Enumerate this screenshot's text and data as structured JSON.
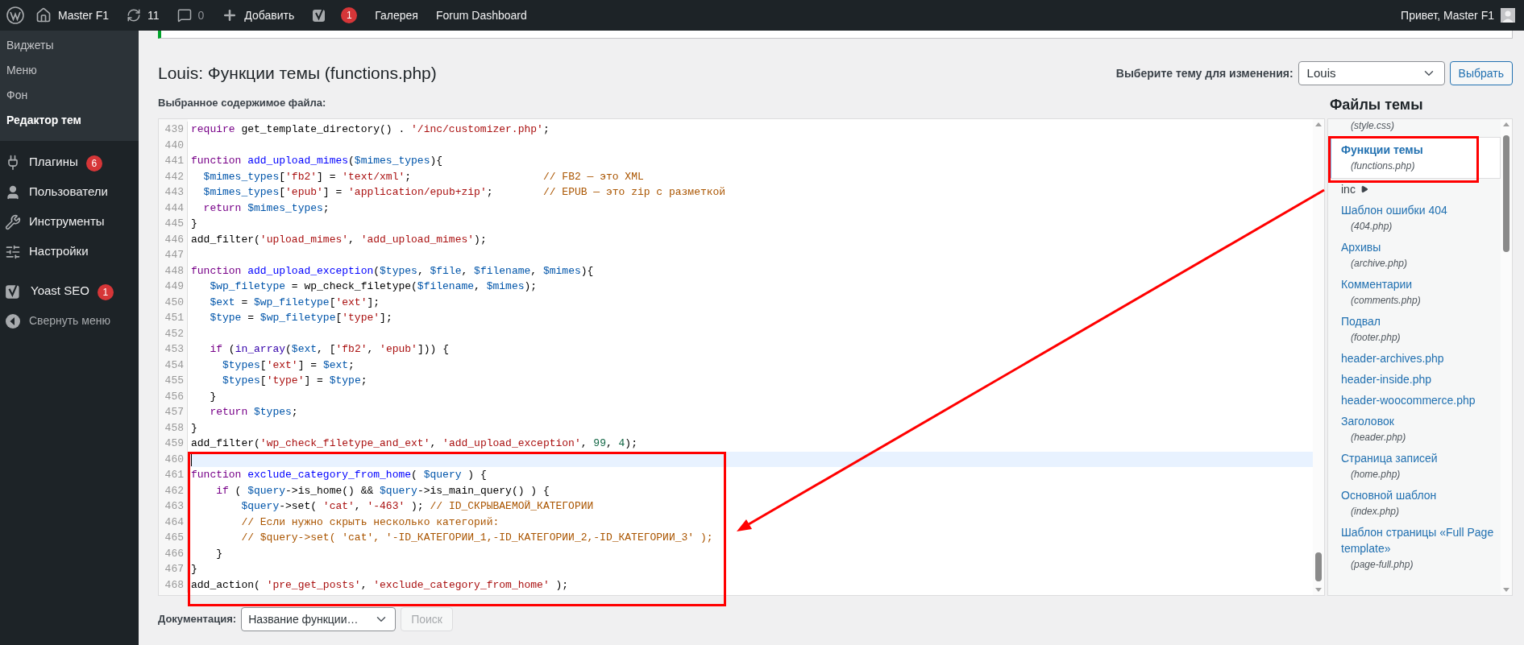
{
  "admin_bar": {
    "items": [
      {
        "label": "Master F1"
      },
      {
        "label": "11"
      },
      {
        "label": "0",
        "muted": true
      },
      {
        "label": "Добавить"
      },
      {
        "badge": "1"
      },
      {
        "label": "Галерея"
      },
      {
        "label": "Forum Dashboard"
      }
    ],
    "greeting": "Привет, Master F1"
  },
  "sidebar": {
    "submenu": [
      {
        "label": "Виджеты",
        "selected": false
      },
      {
        "label": "Меню",
        "selected": false
      },
      {
        "label": "Фон",
        "selected": false
      },
      {
        "label": "Редактор тем",
        "selected": true
      }
    ],
    "menu_groups": [
      {
        "items": [
          {
            "label": "Плагины",
            "badge": "6"
          },
          {
            "label": "Пользователи"
          },
          {
            "label": "Инструменты"
          },
          {
            "label": "Настройки"
          }
        ]
      },
      {
        "items": [
          {
            "label": "Yoast SEO",
            "badge": "1"
          },
          {
            "label": "Свернуть меню",
            "kind": "collapse"
          }
        ]
      }
    ]
  },
  "page": {
    "title": "Louis: Функции темы (functions.php)",
    "theme_picker": {
      "label": "Выберите тему для изменения:",
      "value": "Louis",
      "button": "Выбрать"
    },
    "content_label": "Выбранное содержимое файла:"
  },
  "code": {
    "lines": [
      {
        "number": "439",
        "active": false,
        "tokens": [
          {
            "kind": "keyword",
            "text": "require"
          },
          {
            "kind": "plain",
            "text": " get_template_directory() . "
          },
          {
            "kind": "string",
            "text": "'/inc/customizer.php'"
          },
          {
            "kind": "plain",
            "text": ";"
          }
        ]
      },
      {
        "number": "440",
        "active": false
      },
      {
        "number": "441",
        "active": false,
        "tokens": [
          {
            "kind": "keyword",
            "text": "function "
          },
          {
            "kind": "def",
            "text": "add_upload_mimes"
          },
          {
            "kind": "plain",
            "text": "("
          },
          {
            "kind": "variable",
            "text": "$mimes_types"
          },
          {
            "kind": "plain",
            "text": "){"
          }
        ]
      },
      {
        "number": "442",
        "active": false,
        "tokens": [
          {
            "kind": "variable",
            "text": "  $mimes_types"
          },
          {
            "kind": "plain",
            "text": "["
          },
          {
            "kind": "string",
            "text": "'fb2'"
          },
          {
            "kind": "plain",
            "text": "] = "
          },
          {
            "kind": "string",
            "text": "'text/xml'"
          },
          {
            "kind": "plain",
            "text": ";                     "
          },
          {
            "kind": "comment",
            "text": "// FB2 — это XML"
          }
        ]
      },
      {
        "number": "443",
        "active": false,
        "tokens": [
          {
            "kind": "variable",
            "text": "  $mimes_types"
          },
          {
            "kind": "plain",
            "text": "["
          },
          {
            "kind": "string",
            "text": "'epub'"
          },
          {
            "kind": "plain",
            "text": "] = "
          },
          {
            "kind": "string",
            "text": "'application/epub+zip'"
          },
          {
            "kind": "plain",
            "text": ";        "
          },
          {
            "kind": "comment",
            "text": "// EPUB — это zip с разметкой"
          }
        ]
      },
      {
        "number": "444",
        "active": false,
        "tokens": [
          {
            "kind": "keyword",
            "text": "  return "
          },
          {
            "kind": "variable",
            "text": "$mimes_types"
          },
          {
            "kind": "plain",
            "text": ";"
          }
        ]
      },
      {
        "number": "445",
        "active": false,
        "tokens": [
          {
            "kind": "plain",
            "text": "}"
          }
        ]
      },
      {
        "number": "446",
        "active": false,
        "tokens": [
          {
            "kind": "plain",
            "text": "add_filter("
          },
          {
            "kind": "string",
            "text": "'upload_mimes'"
          },
          {
            "kind": "plain",
            "text": ", "
          },
          {
            "kind": "string",
            "text": "'add_upload_mimes'"
          },
          {
            "kind": "plain",
            "text": ");"
          }
        ]
      },
      {
        "number": "447",
        "active": false
      },
      {
        "number": "448",
        "active": false,
        "tokens": [
          {
            "kind": "keyword",
            "text": "function "
          },
          {
            "kind": "def",
            "text": "add_upload_exception"
          },
          {
            "kind": "plain",
            "text": "("
          },
          {
            "kind": "variable",
            "text": "$types"
          },
          {
            "kind": "plain",
            "text": ", "
          },
          {
            "kind": "variable",
            "text": "$file"
          },
          {
            "kind": "plain",
            "text": ", "
          },
          {
            "kind": "variable",
            "text": "$filename"
          },
          {
            "kind": "plain",
            "text": ", "
          },
          {
            "kind": "variable",
            "text": "$mimes"
          },
          {
            "kind": "plain",
            "text": "){"
          }
        ]
      },
      {
        "number": "449",
        "active": false,
        "tokens": [
          {
            "kind": "variable",
            "text": "   $wp_filetype"
          },
          {
            "kind": "plain",
            "text": " = wp_check_filetype("
          },
          {
            "kind": "variable",
            "text": "$filename"
          },
          {
            "kind": "plain",
            "text": ", "
          },
          {
            "kind": "variable",
            "text": "$mimes"
          },
          {
            "kind": "plain",
            "text": ");"
          }
        ]
      },
      {
        "number": "450",
        "active": false,
        "tokens": [
          {
            "kind": "variable",
            "text": "   $ext"
          },
          {
            "kind": "plain",
            "text": " = "
          },
          {
            "kind": "variable",
            "text": "$wp_filetype"
          },
          {
            "kind": "plain",
            "text": "["
          },
          {
            "kind": "string",
            "text": "'ext'"
          },
          {
            "kind": "plain",
            "text": "];"
          }
        ]
      },
      {
        "number": "451",
        "active": false,
        "tokens": [
          {
            "kind": "variable",
            "text": "   $type"
          },
          {
            "kind": "plain",
            "text": " = "
          },
          {
            "kind": "variable",
            "text": "$wp_filetype"
          },
          {
            "kind": "plain",
            "text": "["
          },
          {
            "kind": "string",
            "text": "'type'"
          },
          {
            "kind": "plain",
            "text": "];"
          }
        ]
      },
      {
        "number": "452",
        "active": false
      },
      {
        "number": "453",
        "active": false,
        "tokens": [
          {
            "kind": "keyword",
            "text": "   if"
          },
          {
            "kind": "plain",
            "text": " ("
          },
          {
            "kind": "builtin",
            "text": "in_array"
          },
          {
            "kind": "plain",
            "text": "("
          },
          {
            "kind": "variable",
            "text": "$ext"
          },
          {
            "kind": "plain",
            "text": ", ["
          },
          {
            "kind": "string",
            "text": "'fb2'"
          },
          {
            "kind": "plain",
            "text": ", "
          },
          {
            "kind": "string",
            "text": "'epub'"
          },
          {
            "kind": "plain",
            "text": "])) {"
          }
        ]
      },
      {
        "number": "454",
        "active": false,
        "tokens": [
          {
            "kind": "variable",
            "text": "     $types"
          },
          {
            "kind": "plain",
            "text": "["
          },
          {
            "kind": "string",
            "text": "'ext'"
          },
          {
            "kind": "plain",
            "text": "] = "
          },
          {
            "kind": "variable",
            "text": "$ext"
          },
          {
            "kind": "plain",
            "text": ";"
          }
        ]
      },
      {
        "number": "455",
        "active": false,
        "tokens": [
          {
            "kind": "variable",
            "text": "     $types"
          },
          {
            "kind": "plain",
            "text": "["
          },
          {
            "kind": "string",
            "text": "'type'"
          },
          {
            "kind": "plain",
            "text": "] = "
          },
          {
            "kind": "variable",
            "text": "$type"
          },
          {
            "kind": "plain",
            "text": ";"
          }
        ]
      },
      {
        "number": "456",
        "active": false,
        "tokens": [
          {
            "kind": "plain",
            "text": "   }"
          }
        ]
      },
      {
        "number": "457",
        "active": false,
        "tokens": [
          {
            "kind": "keyword",
            "text": "   return "
          },
          {
            "kind": "variable",
            "text": "$types"
          },
          {
            "kind": "plain",
            "text": ";"
          }
        ]
      },
      {
        "number": "458",
        "active": false,
        "tokens": [
          {
            "kind": "plain",
            "text": "}"
          }
        ]
      },
      {
        "number": "459",
        "active": false,
        "tokens": [
          {
            "kind": "plain",
            "text": "add_filter("
          },
          {
            "kind": "string",
            "text": "'wp_check_filetype_and_ext'"
          },
          {
            "kind": "plain",
            "text": ", "
          },
          {
            "kind": "string",
            "text": "'add_upload_exception'"
          },
          {
            "kind": "plain",
            "text": ", "
          },
          {
            "kind": "number",
            "text": "99"
          },
          {
            "kind": "plain",
            "text": ", "
          },
          {
            "kind": "number",
            "text": "4"
          },
          {
            "kind": "plain",
            "text": ");"
          }
        ]
      },
      {
        "number": "460",
        "active": true
      },
      {
        "number": "461",
        "active": false,
        "tokens": [
          {
            "kind": "keyword",
            "text": "function "
          },
          {
            "kind": "def",
            "text": "exclude_category_from_home"
          },
          {
            "kind": "plain",
            "text": "( "
          },
          {
            "kind": "variable",
            "text": "$query"
          },
          {
            "kind": "plain",
            "text": " ) {"
          }
        ]
      },
      {
        "number": "462",
        "active": false,
        "tokens": [
          {
            "kind": "keyword",
            "text": "    if"
          },
          {
            "kind": "plain",
            "text": " ( "
          },
          {
            "kind": "variable",
            "text": "$query"
          },
          {
            "kind": "plain",
            "text": "->is_home() && "
          },
          {
            "kind": "variable",
            "text": "$query"
          },
          {
            "kind": "plain",
            "text": "->is_main_query() ) {"
          }
        ]
      },
      {
        "number": "463",
        "active": false,
        "tokens": [
          {
            "kind": "variable",
            "text": "        $query"
          },
          {
            "kind": "plain",
            "text": "->set( "
          },
          {
            "kind": "string",
            "text": "'cat'"
          },
          {
            "kind": "plain",
            "text": ", "
          },
          {
            "kind": "string",
            "text": "'-463'"
          },
          {
            "kind": "plain",
            "text": " ); "
          },
          {
            "kind": "comment",
            "text": "// ID_СКРЫВАЕМОЙ_КАТЕГОРИИ"
          }
        ]
      },
      {
        "number": "464",
        "active": false,
        "tokens": [
          {
            "kind": "comment",
            "text": "        // Если нужно скрыть несколько категорий:"
          }
        ]
      },
      {
        "number": "465",
        "active": false,
        "tokens": [
          {
            "kind": "comment",
            "text": "        // $query->set( 'cat', '-ID_КАТЕГОРИИ_1,-ID_КАТЕГОРИИ_2,-ID_КАТЕГОРИИ_3' );"
          }
        ]
      },
      {
        "number": "466",
        "active": false,
        "tokens": [
          {
            "kind": "plain",
            "text": "    }"
          }
        ]
      },
      {
        "number": "467",
        "active": false,
        "tokens": [
          {
            "kind": "plain",
            "text": "}"
          }
        ]
      },
      {
        "number": "468",
        "active": false,
        "tokens": [
          {
            "kind": "plain",
            "text": "add_action( "
          },
          {
            "kind": "string",
            "text": "'pre_get_posts'"
          },
          {
            "kind": "plain",
            "text": ", "
          },
          {
            "kind": "string",
            "text": "'exclude_category_from_home'"
          },
          {
            "kind": "plain",
            "text": " );"
          }
        ]
      }
    ]
  },
  "files": {
    "heading": "Файлы темы",
    "items": [
      {
        "kind": "file",
        "file": "(style.css)",
        "selected": false
      },
      {
        "kind": "file",
        "title": "Функции темы",
        "file": "(functions.php)",
        "selected": true
      },
      {
        "kind": "folder",
        "title": "inc",
        "selected": false
      },
      {
        "kind": "file",
        "title": "Шаблон ошибки 404",
        "file": "(404.php)",
        "selected": false
      },
      {
        "kind": "file",
        "title": "Архивы",
        "file": "(archive.php)",
        "selected": false
      },
      {
        "kind": "file",
        "title": "Комментарии",
        "file": "(comments.php)",
        "selected": false
      },
      {
        "kind": "file",
        "title": "Подвал",
        "file": "(footer.php)",
        "selected": false
      },
      {
        "kind": "file",
        "title": "header-archives.php",
        "selected": false
      },
      {
        "kind": "file",
        "title": "header-inside.php",
        "selected": false
      },
      {
        "kind": "file",
        "title": "header-woocommerce.php",
        "selected": false
      },
      {
        "kind": "file",
        "title": "Заголовок",
        "file": "(header.php)",
        "selected": false
      },
      {
        "kind": "file",
        "title": "Страница записей",
        "file": "(home.php)",
        "selected": false
      },
      {
        "kind": "file",
        "title": "Основной шаблон",
        "file": "(index.php)",
        "selected": false
      },
      {
        "kind": "file",
        "title": "Шаблон страницы «Full Page template»",
        "file": "(page-full.php)",
        "selected": false
      }
    ]
  },
  "docs": {
    "label": "Документация:",
    "placeholder": "Название функции…",
    "button": "Поиск",
    "button_disabled": true
  }
}
